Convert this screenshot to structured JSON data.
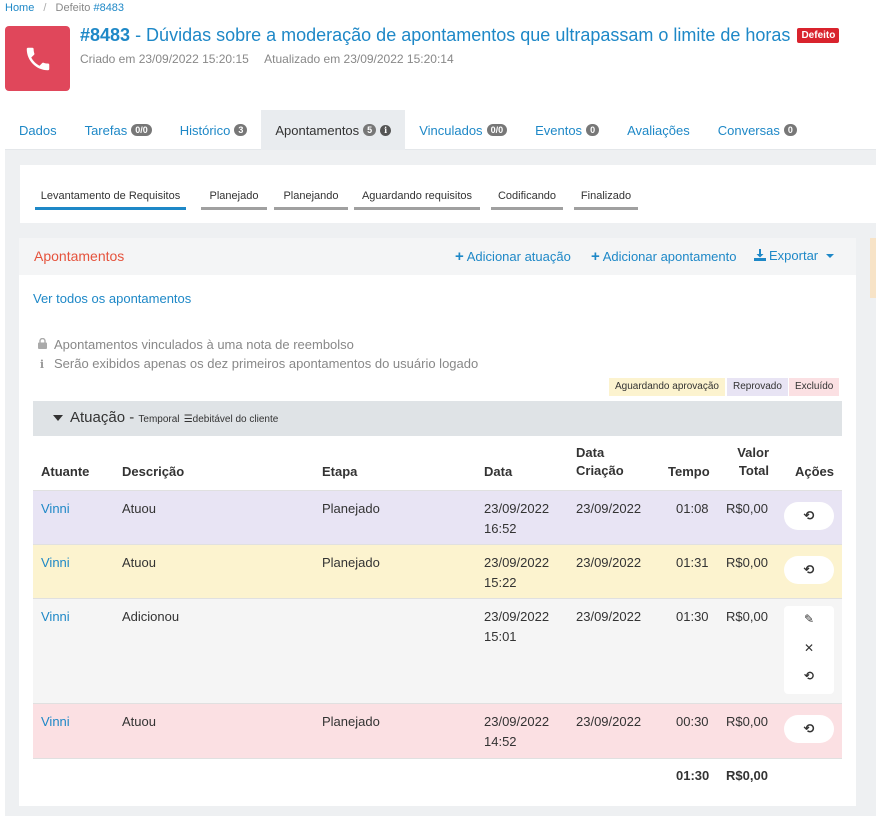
{
  "breadcrumb": {
    "home": "Home",
    "separator": "/",
    "current_prefix": "Defeito",
    "current_id": "#8483"
  },
  "ticket": {
    "number": "#8483",
    "title": " - Dúvidas sobre a moderação de apontamentos que ultrapassam o limite de horas",
    "badge": "Defeito",
    "created": "Criado em 23/09/2022 15:20:15",
    "updated": "Atualizado em 23/09/2022 15:20:14",
    "icon": "phone-icon",
    "icon_color": "#e0475b"
  },
  "tabs": [
    {
      "label": "Dados"
    },
    {
      "label": "Tarefas",
      "badge": "0/0"
    },
    {
      "label": "Histórico",
      "badge": "3"
    },
    {
      "label": "Apontamentos",
      "badge": "5",
      "active": true
    },
    {
      "label": "Vinculados",
      "badge": "0/0"
    },
    {
      "label": "Eventos",
      "badge": "0"
    },
    {
      "label": "Avaliações"
    },
    {
      "label": "Conversas",
      "badge": "0"
    }
  ],
  "stages": [
    {
      "label": "Levantamento de Requisitos",
      "active": true
    },
    {
      "label": "Planejado"
    },
    {
      "label": "Planejando"
    },
    {
      "label": "Aguardando requisitos"
    },
    {
      "label": "Codificando"
    },
    {
      "label": "Finalizado"
    }
  ],
  "panel": {
    "title": "Apontamentos",
    "add_action": "Adicionar atuação",
    "add_apontamento": "Adicionar apontamento",
    "export": "Exportar",
    "view_all": "Ver todos os apontamentos",
    "note_lock": "Apontamentos vinculados à uma nota de reembolso",
    "note_info": "Serão exibidos apenas os dez primeiros apontamentos do usuário logado"
  },
  "legend": [
    {
      "label": "Aguardando aprovação",
      "color": "#fcf3cf"
    },
    {
      "label": "Reprovado",
      "color": "#e8e4f4"
    },
    {
      "label": "Excluído",
      "color": "#fbe0e3"
    }
  ],
  "section": {
    "title": "Atuação",
    "dash": "-",
    "subtitle_temporal": "Temporal",
    "subtitle_debit": "debitável do cliente"
  },
  "table": {
    "headers": {
      "atuante": "Atuante",
      "descricao": "Descrição",
      "etapa": "Etapa",
      "data": "Data",
      "data_criacao_1": "Data",
      "data_criacao_2": "Criação",
      "tempo": "Tempo",
      "valor_1": "Valor",
      "valor_2": "Total",
      "acoes": "Ações"
    },
    "rows": [
      {
        "atuante": "Vinni",
        "descricao": "Atuou",
        "etapa": "Planejado",
        "data_1": "23/09/2022",
        "data_2": "16:52",
        "criacao": "23/09/2022",
        "tempo": "01:08",
        "valor": "R$0,00",
        "color": "#e8e4f4"
      },
      {
        "atuante": "Vinni",
        "descricao": "Atuou",
        "etapa": "Planejado",
        "data_1": "23/09/2022",
        "data_2": "15:22",
        "criacao": "23/09/2022",
        "tempo": "01:31",
        "valor": "R$0,00",
        "color": "#fcf3cf"
      },
      {
        "atuante": "Vinni",
        "descricao": "Adicionou",
        "etapa": "",
        "data_1": "23/09/2022",
        "data_2": "15:01",
        "criacao": "23/09/2022",
        "tempo": "01:30",
        "valor": "R$0,00",
        "color": "#f5f5f5"
      },
      {
        "atuante": "Vinni",
        "descricao": "Atuou",
        "etapa": "Planejado",
        "data_1": "23/09/2022",
        "data_2": "14:52",
        "criacao": "23/09/2022",
        "tempo": "00:30",
        "valor": "R$0,00",
        "color": "#fbe0e3"
      }
    ],
    "totals": {
      "tempo": "01:30",
      "valor": "R$0,00"
    }
  }
}
